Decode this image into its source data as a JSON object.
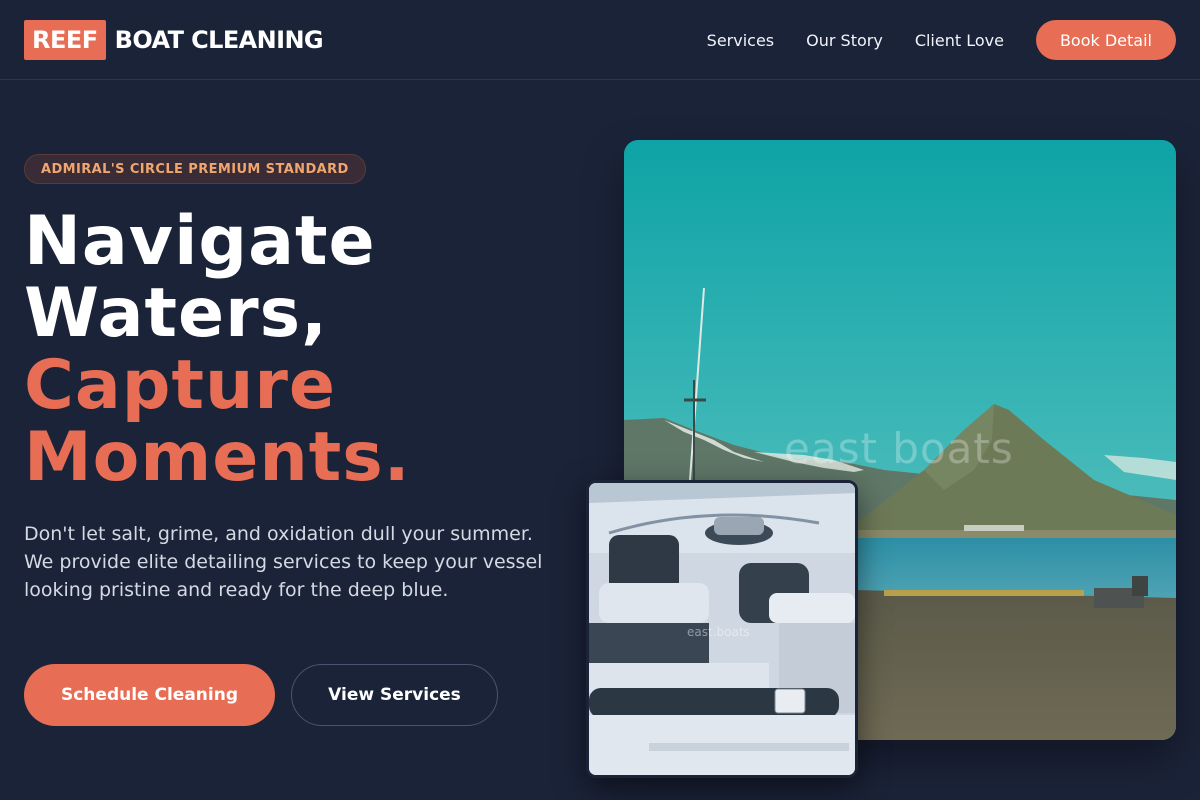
{
  "brand": {
    "logo_box": "REEF",
    "logo_text": "BOAT CLEANING"
  },
  "nav": {
    "items": [
      {
        "label": "Services"
      },
      {
        "label": "Our Story"
      },
      {
        "label": "Client Love"
      }
    ],
    "cta": "Book Detail"
  },
  "hero": {
    "badge": "ADMIRAL'S CIRCLE PREMIUM STANDARD",
    "headline": {
      "line1": "Navigate",
      "line2": "Waters,",
      "line3": "Capture",
      "line4": "Moments."
    },
    "lead": "Don't let salt, grime, and oxidation dull your summer. We provide elite detailing services to keep your vessel looking pristine and ready for the deep blue.",
    "primary_button": "Schedule Cleaning",
    "secondary_button": "View Services"
  },
  "images": {
    "main_watermark": "east boats",
    "inset_watermark": "east.boats"
  },
  "colors": {
    "background": "#1b2339",
    "accent": "#e76d55",
    "badge_text": "#f0a66f"
  }
}
